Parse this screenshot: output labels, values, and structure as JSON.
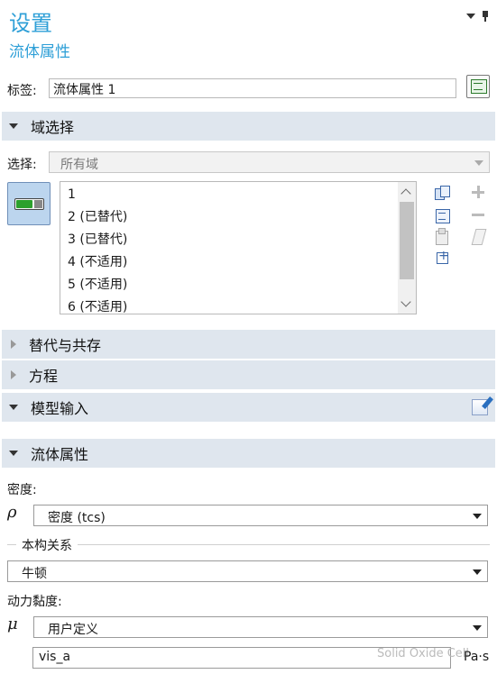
{
  "header": {
    "title": "设置",
    "subtitle": "流体属性"
  },
  "label_field": {
    "label": "标签:",
    "value": "流体属性 1"
  },
  "domain_selection": {
    "section_title": "域选择",
    "selection_label": "选择:",
    "selection_value": "所有域",
    "list_items": [
      "1",
      "2 (已替代)",
      "3 (已替代)",
      "4 (不适用)",
      "5 (不适用)",
      "6 (不适用)"
    ]
  },
  "sections": {
    "override": "替代与共存",
    "equation": "方程",
    "model_input": "模型输入",
    "fluid_properties": "流体属性"
  },
  "fluid_properties": {
    "density_label": "密度:",
    "density_symbol": "ρ",
    "density_value": "密度 (tcs)",
    "constitutive_group": "本构关系",
    "constitutive_value": "牛顿",
    "viscosity_label": "动力黏度:",
    "viscosity_symbol": "μ",
    "viscosity_source": "用户定义",
    "viscosity_value": "vis_a",
    "viscosity_unit": "Pa·s"
  },
  "watermark": "Solid Oxide Cell",
  "colors": {
    "accent": "#2e9fd7",
    "section_bg": "#dfe6ee",
    "toggle_on": "#2ca02c"
  }
}
